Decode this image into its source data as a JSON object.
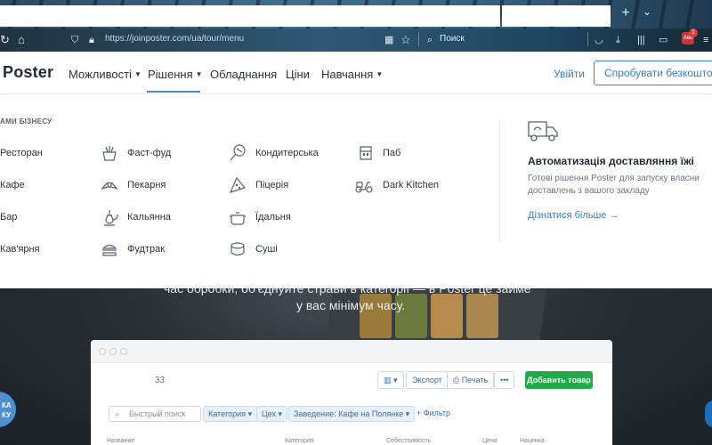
{
  "browser": {
    "url": "https://joinposter.com/ua/tour/menu",
    "search_placeholder": "Поиск",
    "badge": "1",
    "badge_label": "Авв"
  },
  "header": {
    "logo": "Poster",
    "menu": [
      {
        "label": "Можливості",
        "has_caret": true
      },
      {
        "label": "Рішення",
        "has_caret": true,
        "active": true
      },
      {
        "label": "Обладнання",
        "has_caret": false
      },
      {
        "label": "Ціни",
        "has_caret": false
      },
      {
        "label": "Навчання",
        "has_caret": true
      }
    ],
    "login": "Увійти",
    "try_button": "Спробувати безкоштовно",
    "accent": "#2f7fd0"
  },
  "dropdown": {
    "section_title": "АМИ БІЗНЕСУ",
    "business_types": [
      {
        "label": "Ресторан",
        "icon": "restaurant-icon"
      },
      {
        "label": "Кафе",
        "icon": "cafe-icon"
      },
      {
        "label": "Бар",
        "icon": "bar-icon"
      },
      {
        "label": "Кав'ярня",
        "icon": "coffee-icon"
      },
      {
        "label": "Фаст-фуд",
        "icon": "fastfood-icon"
      },
      {
        "label": "Пекарня",
        "icon": "croissant-icon"
      },
      {
        "label": "Кальянна",
        "icon": "hookah-icon"
      },
      {
        "label": "Фудтрак",
        "icon": "burger-icon"
      },
      {
        "label": "Кондитерська",
        "icon": "lollipop-icon"
      },
      {
        "label": "Піцерія",
        "icon": "pizza-icon"
      },
      {
        "label": "Їдальня",
        "icon": "pot-icon"
      },
      {
        "label": "Суші",
        "icon": "sushi-icon"
      },
      {
        "label": "Паб",
        "icon": "beer-icon"
      },
      {
        "label": "Dark Kitchen",
        "icon": "scooter-icon"
      }
    ],
    "promo": {
      "title": "Автоматизація доставляння їжі",
      "text": "Готові рішення Poster для запуску власни доставлень з вашого закладу",
      "link": "Дізнатися більше"
    }
  },
  "hero": {
    "line1": "час обробки, об'єднуйте страви в категорії — в Poster це займе",
    "line2": "у вас мінімум часу."
  },
  "app": {
    "count": "33",
    "export": "Экспорт",
    "print": "Печать",
    "more": "•••",
    "add_product": "Добавить товар",
    "quick_search": "Быстрый поиск",
    "filters": [
      "Категория",
      "Цех",
      "Заведение: Кафе на Полянке"
    ],
    "add_filter": "+ Фильтр",
    "columns": [
      "Название",
      "Категория",
      "Себестоимость",
      "Цена",
      "Наценка"
    ]
  },
  "side_bubble": "КА\nКУ"
}
